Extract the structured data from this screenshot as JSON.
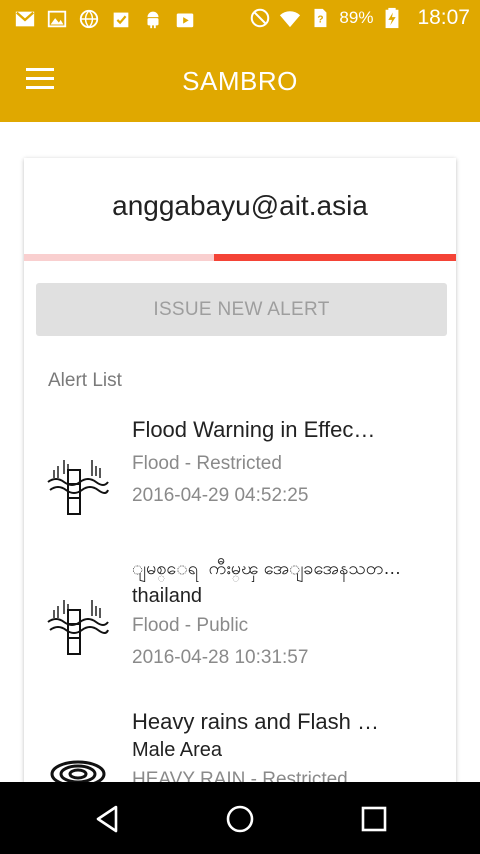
{
  "status_bar": {
    "battery_percent": "89%",
    "time": "18:07",
    "left_icons": [
      "gmail-icon",
      "image-icon",
      "globe-icon",
      "clipboard-check-icon",
      "android-icon",
      "play-store-icon"
    ],
    "right_icons": [
      "do-not-disturb-icon",
      "wifi-icon",
      "sim-unknown-icon",
      "battery-charging-icon"
    ]
  },
  "app_bar": {
    "title": "SAMBRO",
    "menu_icon": "hamburger-menu-icon",
    "background_color": "#e0a800"
  },
  "card": {
    "user_email": "anggabayu@ait.asia",
    "progress_fraction": 0.56,
    "progress_color": "#f44336",
    "issue_button_label": "ISSUE NEW ALERT",
    "list_header": "Alert List"
  },
  "alerts": [
    {
      "title": "Flood Warning in Effec…",
      "area": "",
      "category": "Flood - Restricted",
      "timestamp": "2016-04-29 04:52:25",
      "icon": "flood-icon"
    },
    {
      "title": "ျမစ္ေရ�ကီးမ္ၾ အေျခအေနသတ…",
      "area": "thailand",
      "category": "Flood - Public",
      "timestamp": "2016-04-28 10:31:57",
      "icon": "flood-icon"
    },
    {
      "title": "Heavy rains and Flash …",
      "area": "Male Area",
      "category": "HEAVY RAIN - Restricted",
      "timestamp": "",
      "icon": "heavy-rain-icon"
    }
  ],
  "nav_bar": {
    "back_icon": "back-triangle-icon",
    "home_icon": "home-circle-icon",
    "recents_icon": "recents-square-icon"
  }
}
